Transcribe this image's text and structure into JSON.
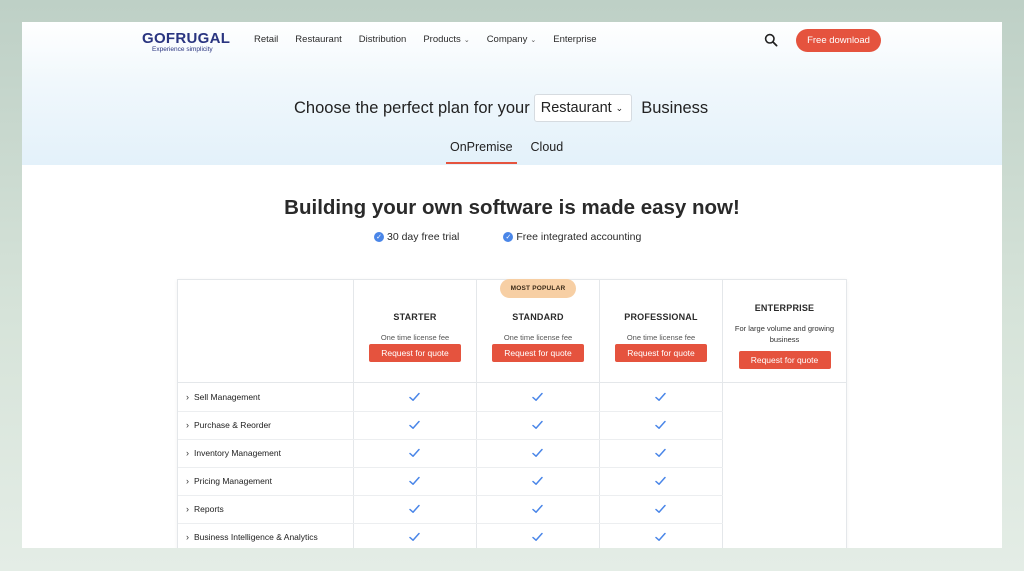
{
  "header": {
    "logo_text": "GOFRUGAL",
    "logo_tagline": "Experience simplicity",
    "nav": [
      {
        "label": "Retail",
        "has_dropdown": false
      },
      {
        "label": "Restaurant",
        "has_dropdown": false
      },
      {
        "label": "Distribution",
        "has_dropdown": false
      },
      {
        "label": "Products",
        "has_dropdown": true
      },
      {
        "label": "Company",
        "has_dropdown": true
      },
      {
        "label": "Enterprise",
        "has_dropdown": false
      }
    ],
    "search_icon": "search-icon",
    "cta_label": "Free download"
  },
  "plan_selector": {
    "prefix": "Choose the perfect plan for your",
    "selected_business": "Restaurant",
    "suffix": "Business",
    "tabs": [
      {
        "label": "OnPremise",
        "active": true
      },
      {
        "label": "Cloud",
        "active": false
      }
    ]
  },
  "hero": {
    "headline": "Building your own software is made easy now!",
    "perks": [
      "30 day free trial",
      "Free integrated accounting"
    ]
  },
  "pricing": {
    "popular_badge": "MOST POPULAR",
    "plans": [
      {
        "name": "STARTER",
        "fee": "One time license fee",
        "button": "Request for quote"
      },
      {
        "name": "STANDARD",
        "fee": "One time license fee",
        "button": "Request for quote"
      },
      {
        "name": "PROFESSIONAL",
        "fee": "One time license fee",
        "button": "Request for quote"
      },
      {
        "name": "ENTERPRISE",
        "desc_line1": "For large volume and growing",
        "desc_line2": "business",
        "button": "Request for quote"
      }
    ],
    "features": [
      "Sell Management",
      "Purchase & Reorder",
      "Inventory Management",
      "Pricing Management",
      "Reports",
      "Business Intelligence & Analytics"
    ]
  },
  "colors": {
    "accent": "#e5533e",
    "brand": "#2a3580",
    "check": "#4a86e8",
    "badge": "#f7cfa4"
  }
}
